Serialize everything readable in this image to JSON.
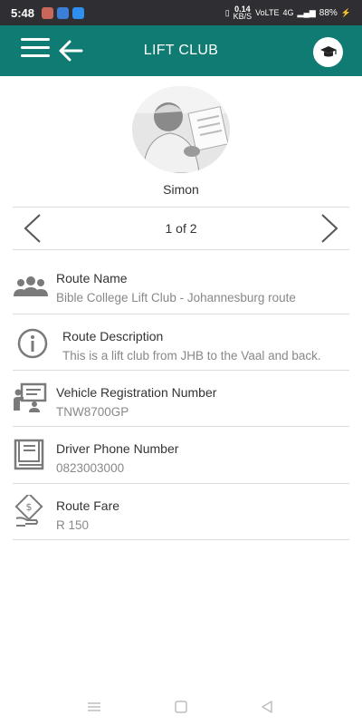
{
  "status": {
    "time": "5:48",
    "data_speed": "0.14",
    "data_unit": "KB/S",
    "network_label": "VoLTE",
    "network_gen": "4G",
    "battery": "88%"
  },
  "appbar": {
    "title": "LIFT CLUB",
    "accent": "#107b72"
  },
  "driver": {
    "name": "Simon"
  },
  "pager": {
    "label": "1 of 2"
  },
  "details": {
    "route_name": {
      "label": "Route Name",
      "value": "Bible College Lift Club - Johannesburg route",
      "icon": "group-icon"
    },
    "route_description": {
      "label": "Route Description",
      "value": "This is a lift club from JHB to the Vaal and back.",
      "icon": "info-icon"
    },
    "vehicle_registration": {
      "label": "Vehicle Registration Number",
      "value": "TNW8700GP",
      "icon": "presentation-icon"
    },
    "driver_phone": {
      "label": "Driver Phone Number",
      "value": "0823003000",
      "icon": "book-icon"
    },
    "route_fare": {
      "label": "Route Fare",
      "value": "R 150",
      "icon": "fare-icon"
    }
  }
}
